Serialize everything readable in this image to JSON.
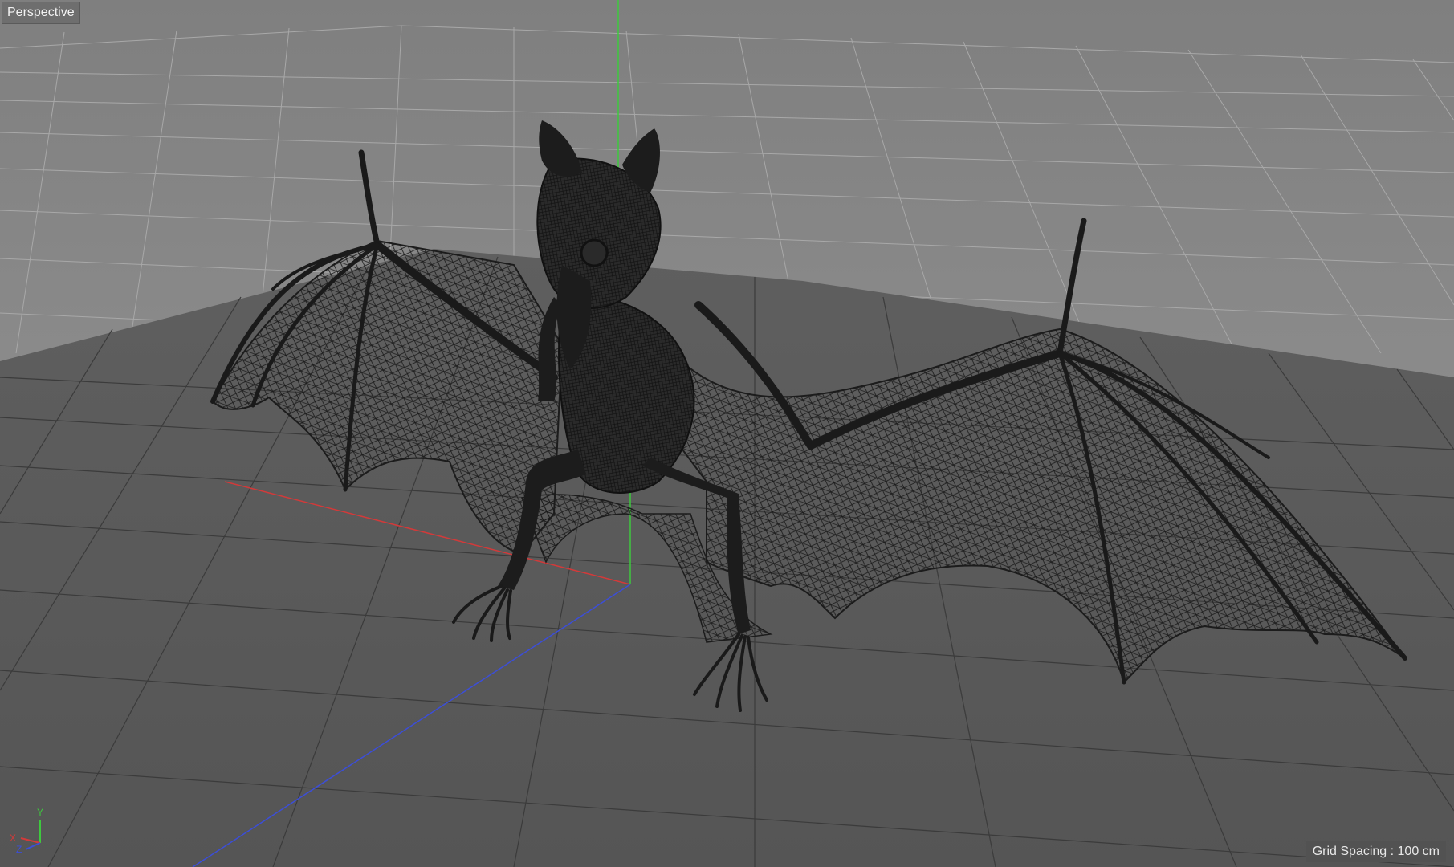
{
  "viewport": {
    "name": "Perspective",
    "grid_spacing_label": "Grid Spacing : 100 cm"
  },
  "axis_gizmo": {
    "x_label": "X",
    "y_label": "Y",
    "z_label": "Z"
  },
  "colors": {
    "background": "#8a8a8a",
    "floor": "#5d5d5d",
    "grid_line": "#3a3a3a",
    "far_grid_line": "#a4a4a4",
    "model_wire": "#1c1c1c",
    "x_axis": "#d23a3a",
    "y_axis": "#3ec83e",
    "z_axis": "#3c4ed8"
  },
  "icons": {
    "axis_gizmo": "xyz-axis-gizmo-icon"
  }
}
